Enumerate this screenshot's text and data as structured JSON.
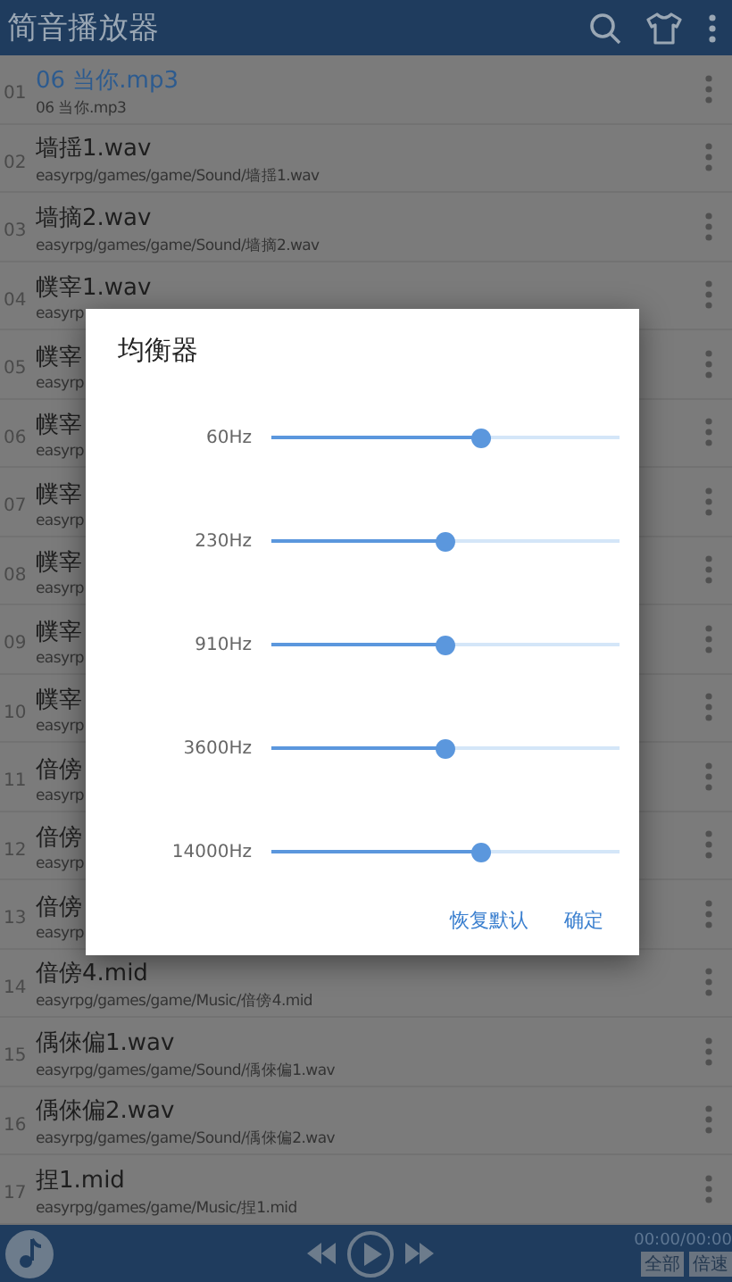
{
  "app_bar": {
    "title": "简音播放器"
  },
  "songs": [
    {
      "number": "01",
      "title": "06 当你.mp3",
      "subtitle": "06 当你.mp3",
      "selected": true
    },
    {
      "number": "02",
      "title": "墙揺1.wav",
      "subtitle": "easyrpg/games/game/Sound/墙揺1.wav",
      "selected": false
    },
    {
      "number": "03",
      "title": "墙摘2.wav",
      "subtitle": "easyrpg/games/game/Sound/墙摘2.wav",
      "selected": false
    },
    {
      "number": "04",
      "title": "幞宰1.wav",
      "subtitle": "easyrp",
      "selected": false
    },
    {
      "number": "05",
      "title": "幞宰",
      "subtitle": "easyrp",
      "selected": false
    },
    {
      "number": "06",
      "title": "幞宰",
      "subtitle": "easyrp",
      "selected": false
    },
    {
      "number": "07",
      "title": "幞宰",
      "subtitle": "easyrp",
      "selected": false
    },
    {
      "number": "08",
      "title": "幞宰",
      "subtitle": "easyrp",
      "selected": false
    },
    {
      "number": "09",
      "title": "幞宰",
      "subtitle": "easyrp",
      "selected": false
    },
    {
      "number": "10",
      "title": "幞宰",
      "subtitle": "easyrp",
      "selected": false
    },
    {
      "number": "11",
      "title": "偣傍",
      "subtitle": "easyrp",
      "selected": false
    },
    {
      "number": "12",
      "title": "偣傍",
      "subtitle": "easyrp",
      "selected": false
    },
    {
      "number": "13",
      "title": "偣傍",
      "subtitle": "easyrp",
      "selected": false
    },
    {
      "number": "14",
      "title": "偣傍4.mid",
      "subtitle": "easyrpg/games/game/Music/偣傍4.mid",
      "selected": false
    },
    {
      "number": "15",
      "title": "偊倈偏1.wav",
      "subtitle": "easyrpg/games/game/Sound/偊倈偏1.wav",
      "selected": false
    },
    {
      "number": "16",
      "title": "偊倈偏2.wav",
      "subtitle": "easyrpg/games/game/Sound/偊倈偏2.wav",
      "selected": false
    },
    {
      "number": "17",
      "title": "捏1.mid",
      "subtitle": "easyrpg/games/game/Music/捏1.mid",
      "selected": false
    }
  ],
  "equalizer": {
    "title": "均衡器",
    "bands": [
      {
        "label": "60Hz",
        "level": 0.6
      },
      {
        "label": "230Hz",
        "level": 0.5
      },
      {
        "label": "910Hz",
        "level": 0.5
      },
      {
        "label": "3600Hz",
        "level": 0.5
      },
      {
        "label": "14000Hz",
        "level": 0.6
      }
    ],
    "buttons": [
      "恢复默认",
      "确定"
    ]
  },
  "player": {
    "time": "00:00/00:00",
    "tags": [
      "全部",
      "倍速"
    ]
  }
}
